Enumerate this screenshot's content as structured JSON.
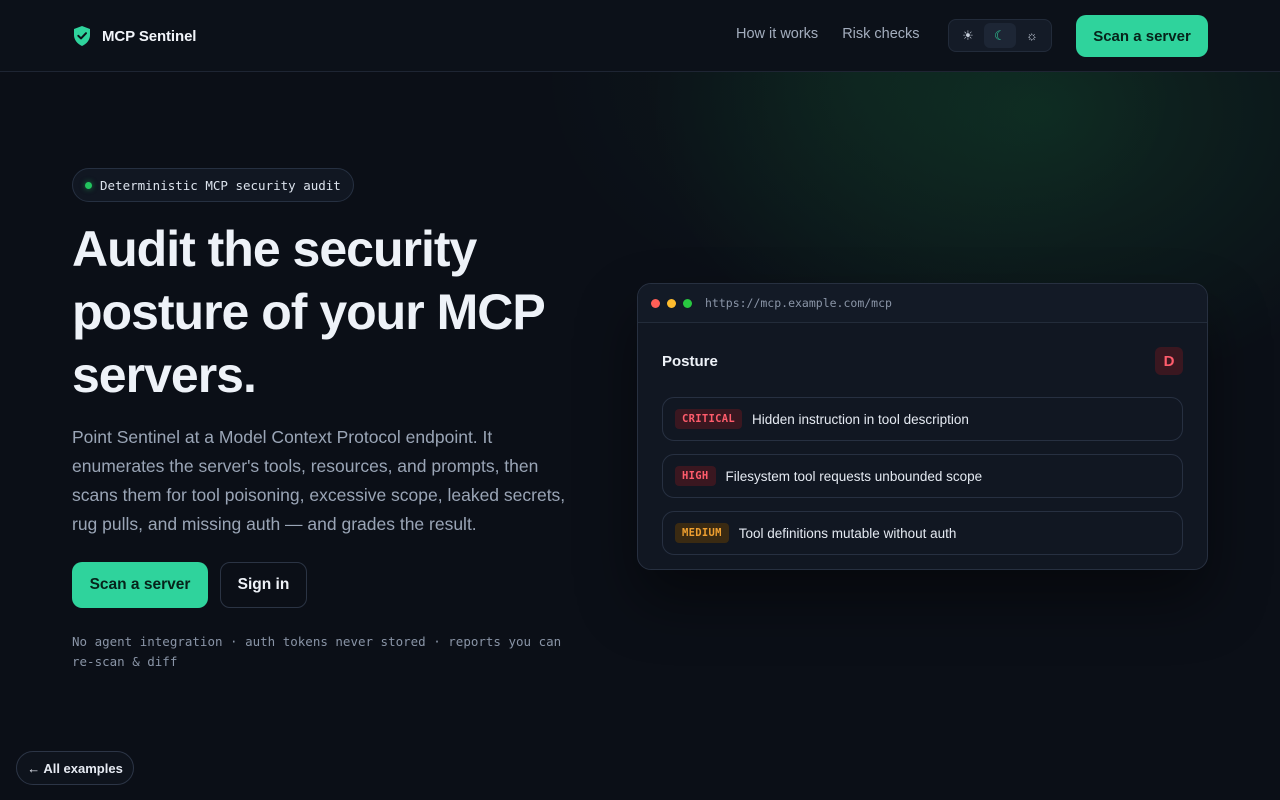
{
  "nav": {
    "brand": "MCP Sentinel",
    "links": [
      "How it works",
      "Risk checks"
    ],
    "theme_icons": [
      "sun-icon",
      "moon-icon",
      "system-icon"
    ],
    "theme_glyphs": [
      "☀",
      "☾",
      "☼"
    ],
    "theme_active": 1,
    "cta": "Scan a server"
  },
  "hero": {
    "badge": "Deterministic MCP security audit",
    "title": "Audit the security posture of your MCP servers.",
    "subtitle": "Point Sentinel at a Model Context Protocol endpoint. It enumerates the server's tools, resources, and prompts, then scans them for tool poisoning, excessive scope, leaked secrets, rug pulls, and missing auth — and grades the result.",
    "primary_cta": "Scan a server",
    "secondary_cta": "Sign in",
    "footnote": "No agent integration · auth tokens never stored · reports you can re-scan & diff"
  },
  "card": {
    "url": "https://mcp.example.com/mcp",
    "heading": "Posture",
    "grade": "D",
    "findings": [
      {
        "severity": "CRITICAL",
        "text": "Hidden instruction in tool description",
        "fg": "#ff5c6c",
        "bg": "#3a1720"
      },
      {
        "severity": "HIGH",
        "text": "Filesystem tool requests unbounded scope",
        "fg": "#ff5c6c",
        "bg": "#3a1720"
      },
      {
        "severity": "MEDIUM",
        "text": "Tool definitions mutable without auth",
        "fg": "#f0a030",
        "bg": "#3a2a12"
      }
    ]
  },
  "colors": {
    "accent": "#2fd39c",
    "window_dots": [
      "#ff5f57",
      "#febc2e",
      "#28c840"
    ]
  },
  "back_link": "← All examples"
}
